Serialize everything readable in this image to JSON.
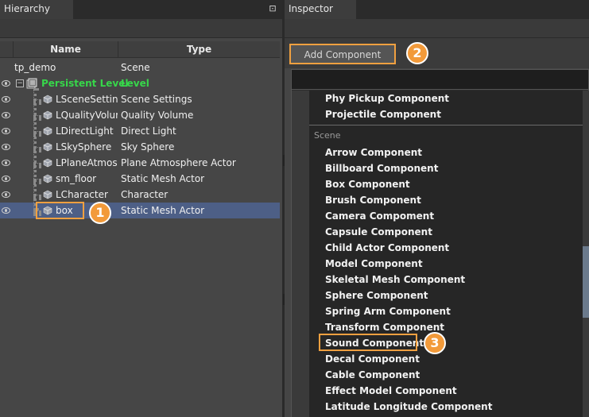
{
  "hierarchy": {
    "tab_label": "Hierarchy",
    "pin_glyph": "⊡",
    "columns": {
      "name": "Name",
      "type": "Type"
    },
    "root": {
      "name": "tp_demo",
      "type": "Scene"
    },
    "level": {
      "name": "Persistent Level",
      "type": "Level",
      "color": "#37d64a"
    },
    "actors": [
      {
        "name": "LSceneSetting",
        "type": "Scene Settings"
      },
      {
        "name": "LQualityVolur",
        "type": "Quality Volume"
      },
      {
        "name": "LDirectLight",
        "type": "Direct Light"
      },
      {
        "name": "LSkySphere",
        "type": "Sky Sphere"
      },
      {
        "name": "LPlaneAtmosp",
        "type": "Plane Atmosphere Actor"
      },
      {
        "name": "sm_floor",
        "type": "Static Mesh Actor"
      },
      {
        "name": "LCharacter",
        "type": "Character"
      },
      {
        "name": "box",
        "type": "Static Mesh Actor"
      }
    ],
    "selected_color": "#4d5f86"
  },
  "inspector": {
    "tab_label": "Inspector",
    "add_component_label": "Add Component",
    "components_top": [
      "Phy Pickup Component",
      "Projectile Component"
    ],
    "category": "Scene",
    "components_scene": [
      "Arrow Component",
      "Billboard Component",
      "Box Component",
      "Brush Component",
      "Camera Compoment",
      "Capsule Component",
      "Child Actor Component",
      "Model Component",
      "Skeletal Mesh Component",
      "Sphere Component",
      "Spring Arm Component",
      "Transform Component",
      "Sound Component",
      "Decal Component",
      "Cable Component",
      "Effect Model Component",
      "Latitude Longitude Component"
    ]
  },
  "annotations": {
    "badge_1": "1",
    "badge_2": "2",
    "badge_3": "3",
    "highlight_color": "#f0a040",
    "badge_color": "#f29a3a"
  }
}
